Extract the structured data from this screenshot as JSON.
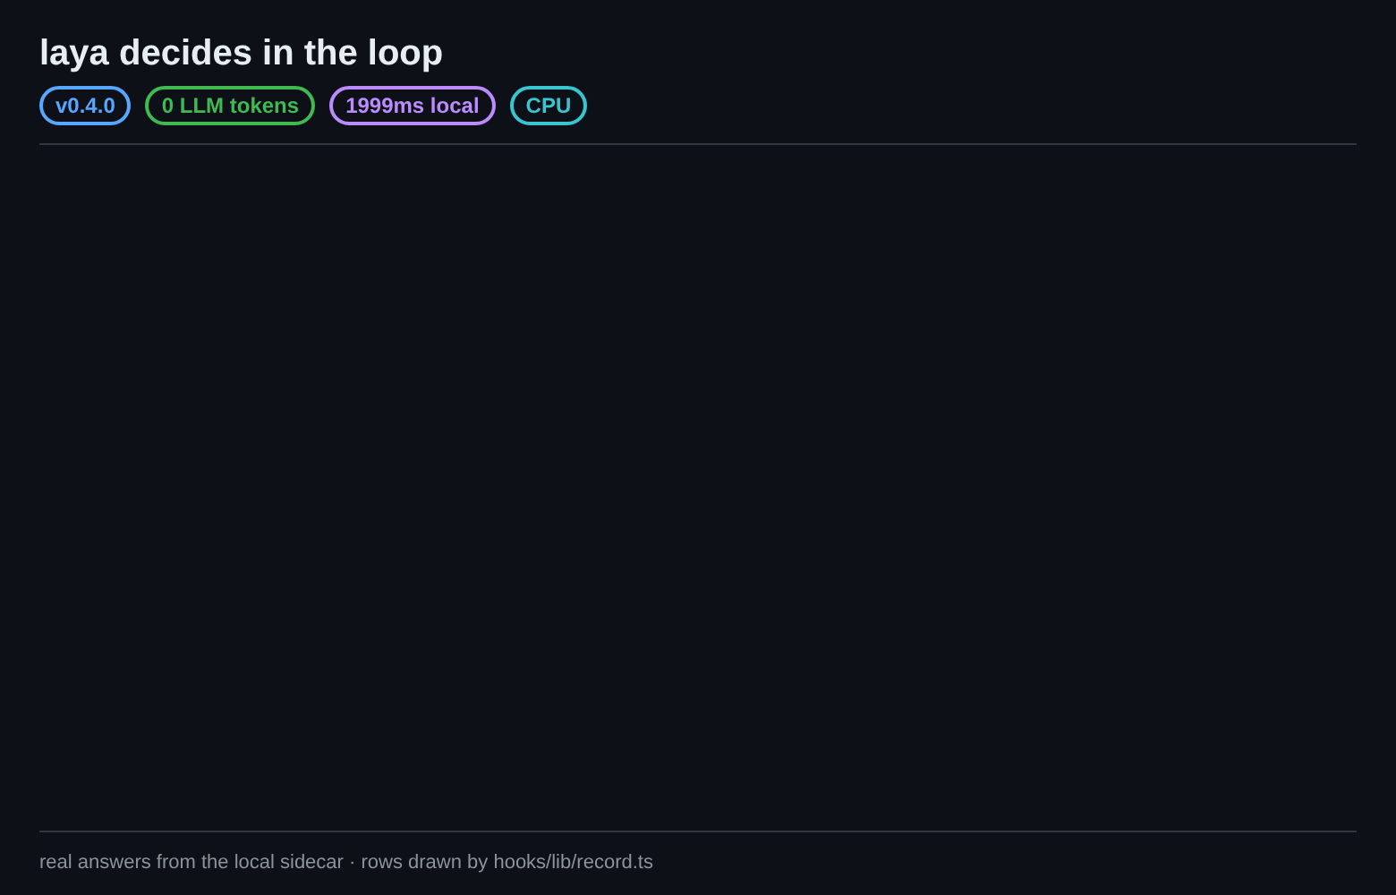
{
  "header": {
    "title": "laya decides in the loop",
    "badges": [
      {
        "label": "v0.4.0",
        "color": "#58a6ff"
      },
      {
        "label": "0 LLM tokens",
        "color": "#3fb950"
      },
      {
        "label": "1999ms local",
        "color": "#bc8cff"
      },
      {
        "label": "CPU",
        "color": "#39c5cf"
      }
    ]
  },
  "footer": {
    "text": "real answers from the local sidecar · rows drawn by hooks/lib/record.ts"
  }
}
